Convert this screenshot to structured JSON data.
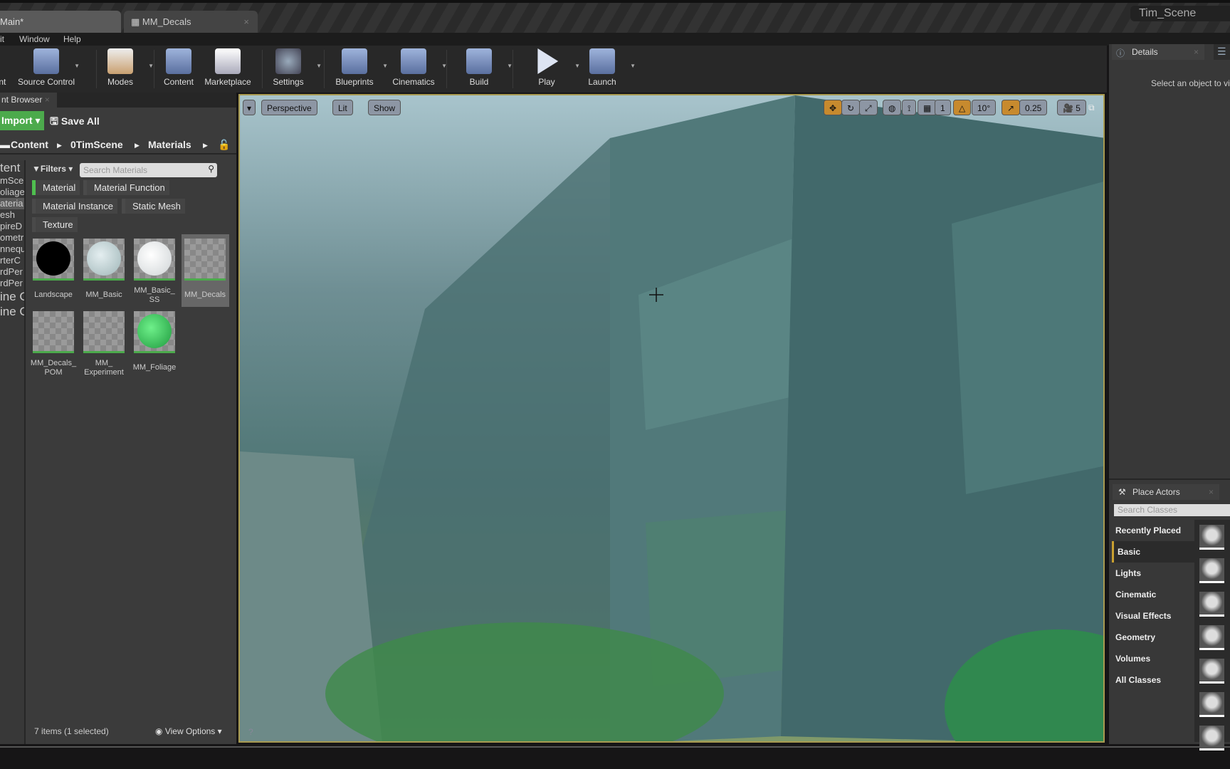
{
  "window": {
    "tabs": [
      {
        "label": "Main*"
      },
      {
        "label": "MM_Decals"
      }
    ],
    "project": "Tim_Scene"
  },
  "menu": [
    "it",
    "Window",
    "Help"
  ],
  "toolbar": [
    {
      "label": "ent"
    },
    {
      "label": "Source Control"
    },
    {
      "label": "Modes"
    },
    {
      "label": "Content"
    },
    {
      "label": "Marketplace"
    },
    {
      "label": "Settings"
    },
    {
      "label": "Blueprints"
    },
    {
      "label": "Cinematics"
    },
    {
      "label": "Build"
    },
    {
      "label": "Play"
    },
    {
      "label": "Launch"
    }
  ],
  "content_browser": {
    "tab": "nt Browser",
    "import": "Import",
    "save_all": "Save All",
    "breadcrumb": [
      "Content",
      "0TimScene",
      "Materials"
    ],
    "tree": [
      "tent",
      "mSce",
      "oliage",
      "ateria",
      "esh",
      "pireD",
      "ometr",
      "nnequ",
      "rterC",
      "rdPer",
      "rdPer",
      "ine C",
      "ine C"
    ],
    "filters": "Filters",
    "search_placeholder": "Search Materials",
    "chips": [
      {
        "label": "Material",
        "active": true
      },
      {
        "label": "Material Function",
        "active": false
      },
      {
        "label": "Material Instance",
        "active": false
      },
      {
        "label": "Static Mesh",
        "active": false
      },
      {
        "label": "Texture",
        "active": false
      }
    ],
    "assets": [
      {
        "name": "Landscape"
      },
      {
        "name": "MM_Basic"
      },
      {
        "name": "MM_Basic_ SS"
      },
      {
        "name": "MM_Decals",
        "selected": true
      },
      {
        "name": "MM_Decals_ POM"
      },
      {
        "name": "MM_ Experiment"
      },
      {
        "name": "MM_Foliage"
      }
    ],
    "status": "7 items (1 selected)",
    "view_options": "View Options"
  },
  "viewport": {
    "perspective": "Perspective",
    "lit": "Lit",
    "show": "Show",
    "grid_snap": "1",
    "rot_snap": "10°",
    "scale_snap": "0.25",
    "cam_speed": "5",
    "border_color": "#a89a50"
  },
  "details": {
    "tab": "Details",
    "message": "Select an object to vi"
  },
  "place_actors": {
    "tab": "Place Actors",
    "search_placeholder": "Search Classes",
    "categories": [
      "Recently Placed",
      "Basic",
      "Lights",
      "Cinematic",
      "Visual Effects",
      "Geometry",
      "Volumes",
      "All Classes"
    ],
    "active": "Basic"
  }
}
